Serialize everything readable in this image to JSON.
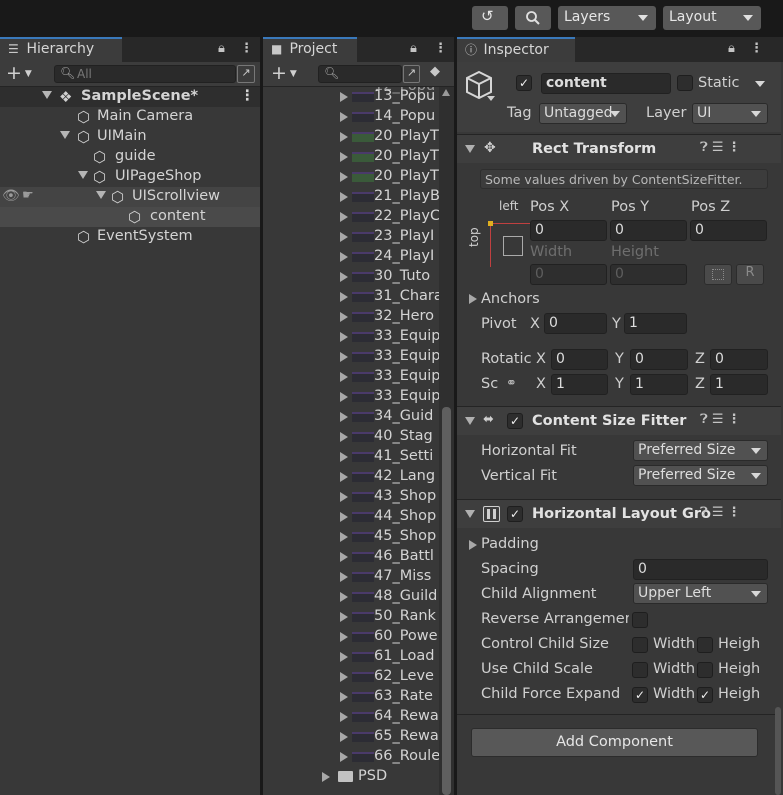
{
  "toolbar": {
    "layers_label": "Layers",
    "layout_label": "Layout"
  },
  "hierarchy": {
    "tab_label": "Hierarchy",
    "search_placeholder": "All",
    "scene_name": "SampleScene*",
    "items": [
      {
        "label": "Main Camera"
      },
      {
        "label": "UIMain"
      },
      {
        "label": "guide"
      },
      {
        "label": "UIPageShop"
      },
      {
        "label": "UIScrollview"
      },
      {
        "label": "content"
      },
      {
        "label": "EventSystem"
      }
    ]
  },
  "project": {
    "tab_label": "Project",
    "items": [
      "13_Popu",
      "14_Popu",
      "20_PlayT",
      "20_PlayT",
      "20_PlayT",
      "21_PlayB",
      "22_PlayC",
      "23_PlayI",
      "24_PlayI",
      "30_Tuto",
      "31_Chara",
      "32_Hero",
      "33_Equip",
      "33_Equip",
      "33_Equip",
      "33_Equip",
      "34_Guid",
      "40_Stag",
      "41_Setti",
      "42_Lang",
      "43_Shop",
      "44_Shop",
      "45_Shop",
      "46_Battl",
      "47_Miss",
      "48_Guild",
      "50_Rank",
      "60_Powe",
      "61_Load",
      "62_Leve",
      "63_Rate",
      "64_Rewa",
      "65_Rewa",
      "66_Roule"
    ],
    "folder": "PSD"
  },
  "inspector": {
    "tab_label": "Inspector",
    "object_name": "content",
    "static_label": "Static",
    "tag_label": "Tag",
    "tag_value": "Untagged",
    "layer_label": "Layer",
    "layer_value": "UI",
    "rect_transform": {
      "title": "Rect Transform",
      "note": "Some values driven by ContentSizeFitter.",
      "anchor_h": "left",
      "anchor_v": "top",
      "pos_x_label": "Pos X",
      "pos_x": "0",
      "pos_y_label": "Pos Y",
      "pos_y": "0",
      "pos_z_label": "Pos Z",
      "pos_z": "0",
      "width_label": "Width",
      "width": "0",
      "height_label": "Height",
      "height": "0",
      "r_button": "R",
      "anchors_label": "Anchors",
      "pivot_label": "Pivot",
      "pivot_x": "0",
      "pivot_y": "1",
      "rotation_label": "Rotatic",
      "rot_x": "0",
      "rot_y": "0",
      "rot_z": "0",
      "scale_label": "Sc",
      "scale_x": "1",
      "scale_y": "1",
      "scale_z": "1",
      "x": "X",
      "y": "Y",
      "z": "Z"
    },
    "content_size_fitter": {
      "title": "Content Size Fitter",
      "h_fit_label": "Horizontal Fit",
      "h_fit": "Preferred Size",
      "v_fit_label": "Vertical Fit",
      "v_fit": "Preferred Size"
    },
    "horizontal_layout_group": {
      "title": "Horizontal Layout Gro",
      "padding_label": "Padding",
      "spacing_label": "Spacing",
      "spacing": "0",
      "child_alignment_label": "Child Alignment",
      "child_alignment": "Upper Left",
      "reverse_label": "Reverse Arrangemen",
      "control_size_label": "Control Child Size",
      "use_scale_label": "Use Child Scale",
      "force_expand_label": "Child Force Expand",
      "width_label": "Width",
      "height_label": "Heigh"
    },
    "add_component_label": "Add Component"
  }
}
